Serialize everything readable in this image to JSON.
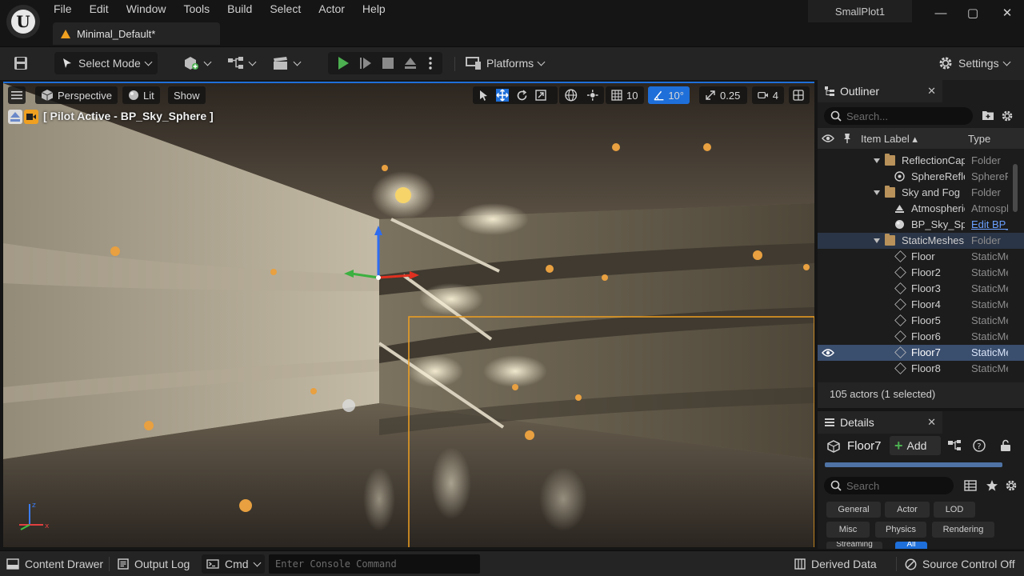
{
  "menu": [
    "File",
    "Edit",
    "Window",
    "Tools",
    "Build",
    "Select",
    "Actor",
    "Help"
  ],
  "project_tab": "Minimal_Default*",
  "project_name": "SmallPlot1",
  "window_controls": {
    "minimize": "—",
    "maximize": "▢",
    "close": "✕"
  },
  "toolbar": {
    "select_mode": "Select Mode",
    "platforms": "Platforms",
    "settings": "Settings"
  },
  "viewport": {
    "perspective": "Perspective",
    "lit": "Lit",
    "show": "Show",
    "grid_snap": "10",
    "angle_snap": "10°",
    "scale_snap": "0.25",
    "camera_speed": "4",
    "pilot_label": "[ Pilot Active - BP_Sky_Sphere ]"
  },
  "outliner": {
    "title": "Outliner",
    "close": "✕",
    "search_placeholder": "Search...",
    "col_label": "Item Label ▴",
    "col_type": "Type",
    "rows": [
      {
        "label": "ReflectionCapture",
        "type": "Folder"
      },
      {
        "label": "SphereReflectionCapture",
        "type": "SphereReflectionCapture"
      },
      {
        "label": "Sky and Fog",
        "type": "Folder"
      },
      {
        "label": "AtmosphericFog",
        "type": "AtmosphericFog"
      },
      {
        "label": "BP_Sky_Sphere",
        "type": "Edit BP_Sky_Sphere"
      },
      {
        "label": "StaticMeshes",
        "type": "Folder"
      },
      {
        "label": "Floor",
        "type": "StaticMeshActor"
      },
      {
        "label": "Floor2",
        "type": "StaticMeshActor"
      },
      {
        "label": "Floor3",
        "type": "StaticMeshActor"
      },
      {
        "label": "Floor4",
        "type": "StaticMeshActor"
      },
      {
        "label": "Floor5",
        "type": "StaticMeshActor"
      },
      {
        "label": "Floor6",
        "type": "StaticMeshActor"
      },
      {
        "label": "Floor7",
        "type": "StaticMeshActor"
      },
      {
        "label": "Floor8",
        "type": "StaticMeshActor"
      }
    ],
    "footer": "105 actors (1 selected)"
  },
  "details": {
    "title": "Details",
    "close": "✕",
    "selected": "Floor7",
    "add": "Add",
    "search_placeholder": "Search",
    "filters": [
      "General",
      "Actor",
      "LOD",
      "Misc",
      "Physics",
      "Rendering"
    ],
    "partial_filters": [
      "Streaming",
      "All"
    ]
  },
  "statusbar": {
    "content_drawer": "Content Drawer",
    "output_log": "Output Log",
    "cmd": "Cmd",
    "console_placeholder": "Enter Console Command",
    "derived_data": "Derived Data",
    "source_control": "Source Control Off"
  },
  "colors": {
    "accent_blue": "#1e6fd9",
    "play_green": "#4caf50",
    "selection_orange": "#f0a020",
    "selected_row": "#3a4e6e"
  }
}
